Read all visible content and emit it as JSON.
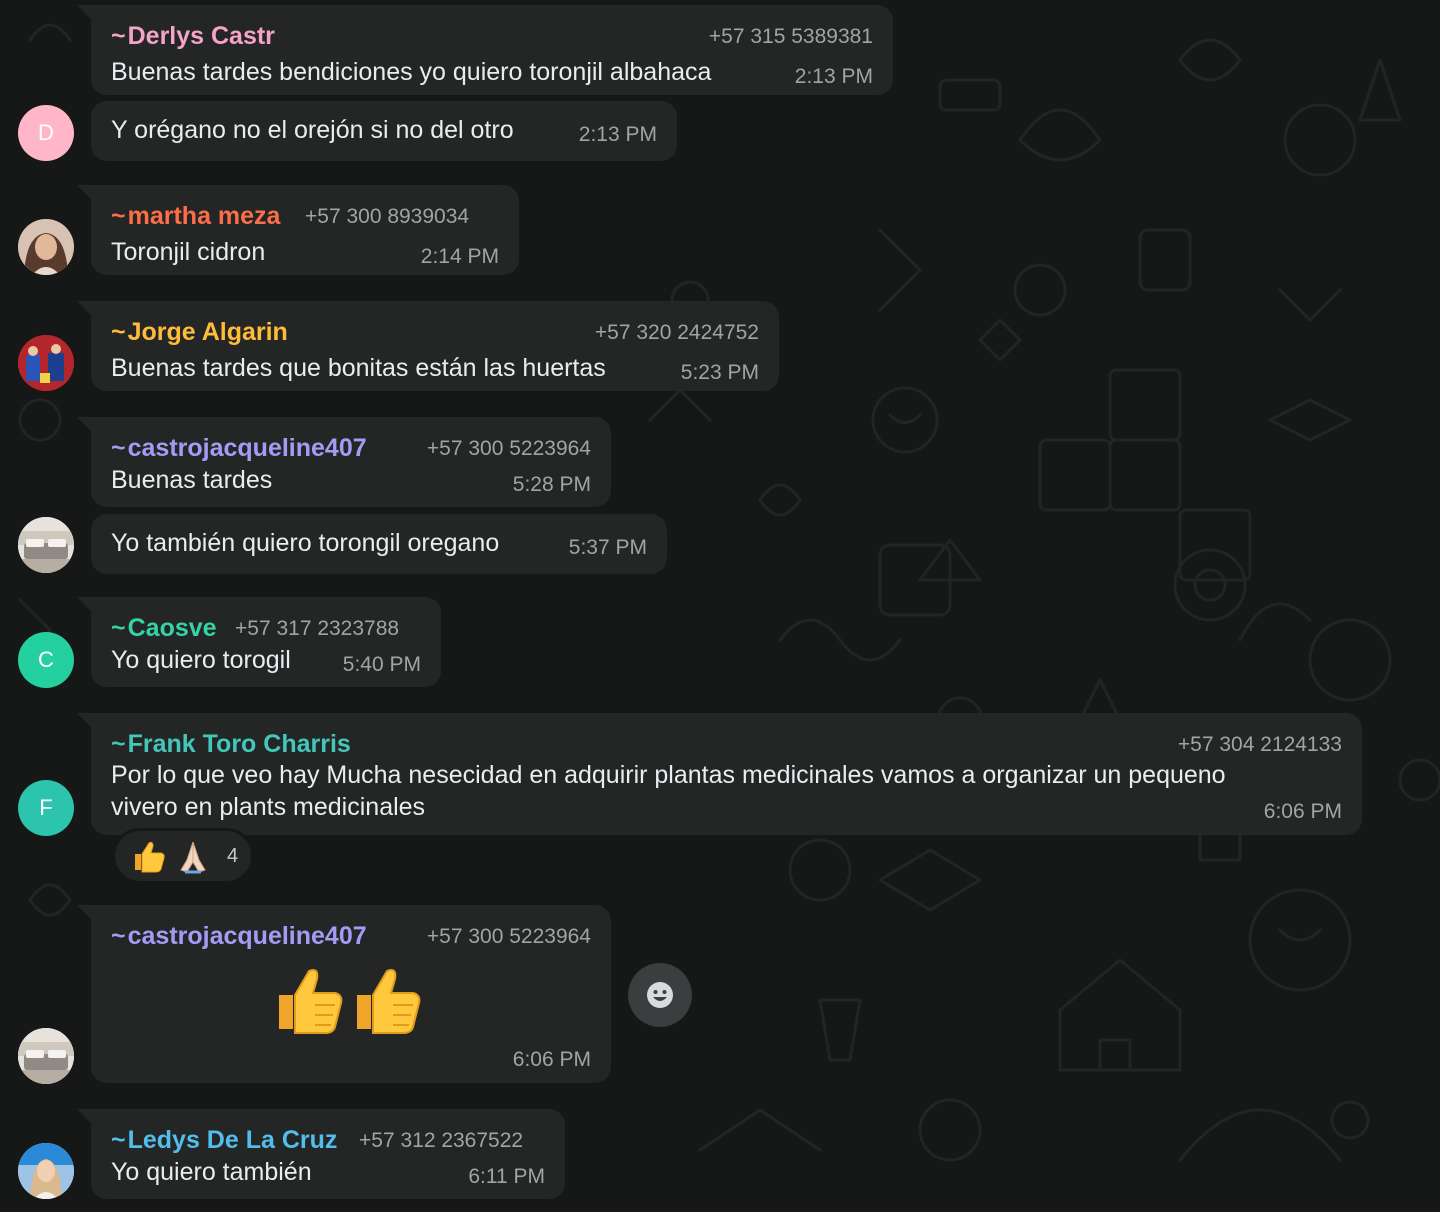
{
  "messages": [
    {
      "sender": "Derlys Castr",
      "phone": "+57 315 5389381",
      "text": "Buenas tardes bendiciones yo quiero toronjil albahaca",
      "time": "2:13 PM"
    },
    {
      "text": "Y orégano no el orejón si no del otro",
      "time": "2:13 PM",
      "avatar_letter": "D"
    },
    {
      "sender": "martha meza",
      "phone": "+57 300 8939034",
      "text": "Toronjil cidron",
      "time": "2:14 PM"
    },
    {
      "sender": "Jorge Algarin",
      "phone": "+57 320 2424752",
      "text": "Buenas tardes que bonitas están las huertas",
      "time": "5:23 PM"
    },
    {
      "sender": "castrojacqueline407",
      "phone": "+57 300 5223964",
      "text": "Buenas tardes",
      "time": "5:28 PM"
    },
    {
      "text": "Yo también quiero torongil oregano",
      "time": "5:37 PM"
    },
    {
      "sender": "Caosve",
      "phone": "+57 317 2323788",
      "text": "Yo quiero torogil",
      "time": "5:40 PM",
      "avatar_letter": "C"
    },
    {
      "sender": "Frank Toro Charris",
      "phone": "+57 304 2124133",
      "text_line1": "Por lo que veo hay Mucha nesecidad en adquirir plantas medicinales  vamos a  organizar un pequeno",
      "text_line2": "vivero en plants medicinales",
      "time": "6:06 PM",
      "avatar_letter": "F",
      "reaction_count": "4"
    },
    {
      "sender": "castrojacqueline407",
      "phone": "+57 300 5223964",
      "time": "6:06 PM"
    },
    {
      "sender": "Ledys De La Cruz",
      "phone": "+57 312 2367522",
      "text": "Yo quiero también",
      "time": "6:11 PM"
    }
  ],
  "tilde": "~",
  "colors": {
    "background": "#161717",
    "bubble": "#242626",
    "derlys": "#f5a3c7",
    "martha": "#fc6e47",
    "jorge": "#ffbc38",
    "castro": "#a39cf6",
    "caosve": "#35d3a5",
    "frank": "#42c7b8",
    "ledys": "#53bdeb",
    "avatar_d": "#ffb6c8",
    "avatar_c": "#25d0a0",
    "avatar_f": "#2cc4ad"
  },
  "icons": {
    "thumbs_up": "thumbs-up-icon",
    "folded_hands": "folded-hands-icon",
    "smiley": "smiley-icon"
  }
}
